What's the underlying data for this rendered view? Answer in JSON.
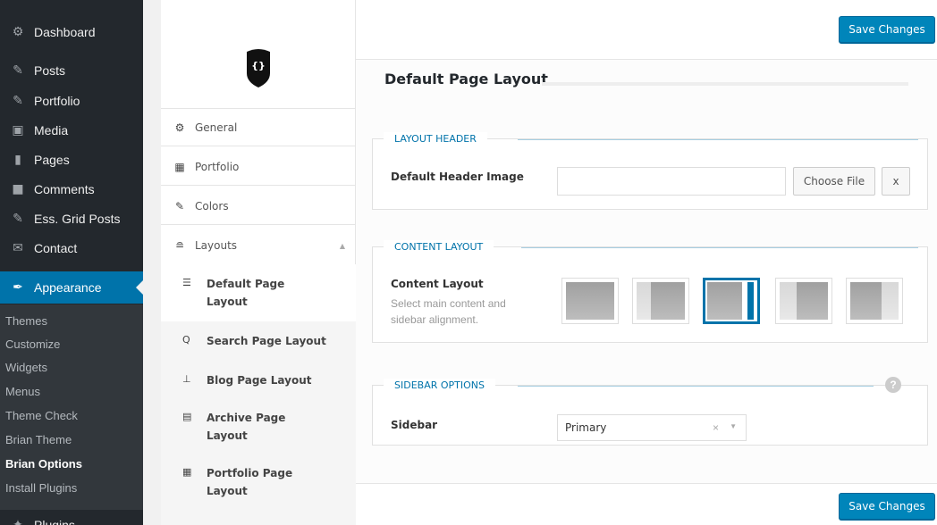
{
  "wp_menu": {
    "items": [
      {
        "label": "Dashboard",
        "icon": "dashboard-icon"
      },
      {
        "label": "Posts",
        "icon": "pin-icon"
      },
      {
        "label": "Portfolio",
        "icon": "pin-icon"
      },
      {
        "label": "Media",
        "icon": "media-icon"
      },
      {
        "label": "Pages",
        "icon": "pages-icon"
      },
      {
        "label": "Comments",
        "icon": "comment-icon"
      },
      {
        "label": "Ess. Grid Posts",
        "icon": "pin-icon"
      },
      {
        "label": "Contact",
        "icon": "mail-icon"
      },
      {
        "label": "Appearance",
        "icon": "brush-icon"
      },
      {
        "label": "Plugins",
        "icon": "plugin-icon"
      }
    ],
    "submenu": [
      "Themes",
      "Customize",
      "Widgets",
      "Menus",
      "Theme Check",
      "Brian Theme",
      "Brian Options",
      "Install Plugins"
    ]
  },
  "options_nav": {
    "logo_text": "{}",
    "items": [
      {
        "label": "General",
        "icon": "gears-icon"
      },
      {
        "label": "Portfolio",
        "icon": "grid-icon"
      },
      {
        "label": "Colors",
        "icon": "brush-icon"
      },
      {
        "label": "Layouts",
        "icon": "layers-icon"
      }
    ],
    "layouts_sub": [
      {
        "line1": "Default Page",
        "line2": "Layout",
        "icon": "list-icon"
      },
      {
        "line1": "Search Page Layout",
        "line2": "",
        "icon": "search-icon"
      },
      {
        "line1": "Blog Page Layout",
        "line2": "",
        "icon": "pin-icon"
      },
      {
        "line1": "Archive Page",
        "line2": "Layout",
        "icon": "archive-icon"
      },
      {
        "line1": "Portfolio Page",
        "line2": "Layout",
        "icon": "grid-icon"
      }
    ]
  },
  "main": {
    "save_label": "Save Changes",
    "section_title": "Default Page Layout",
    "layout_header": {
      "legend": "LAYOUT HEADER",
      "label": "Default Header Image",
      "input_value": "",
      "choose_label": "Choose File",
      "clear_label": "x"
    },
    "content_layout": {
      "legend": "CONTENT LAYOUT",
      "label": "Content Layout",
      "desc_line1": "Select main content and",
      "desc_line2": "sidebar alignment.",
      "options": [
        "full-width",
        "left-sidebar",
        "right-sidebar",
        "two-left-sidebars",
        "two-right-sidebars"
      ],
      "selected_index": 2
    },
    "sidebar_options": {
      "legend": "SIDEBAR OPTIONS",
      "label": "Sidebar",
      "selected": "Primary",
      "clear": "×",
      "help": "?"
    }
  },
  "colors": {
    "wp_bg": "#23282d",
    "wp_active": "#0073aa",
    "button_primary": "#0085ba"
  }
}
